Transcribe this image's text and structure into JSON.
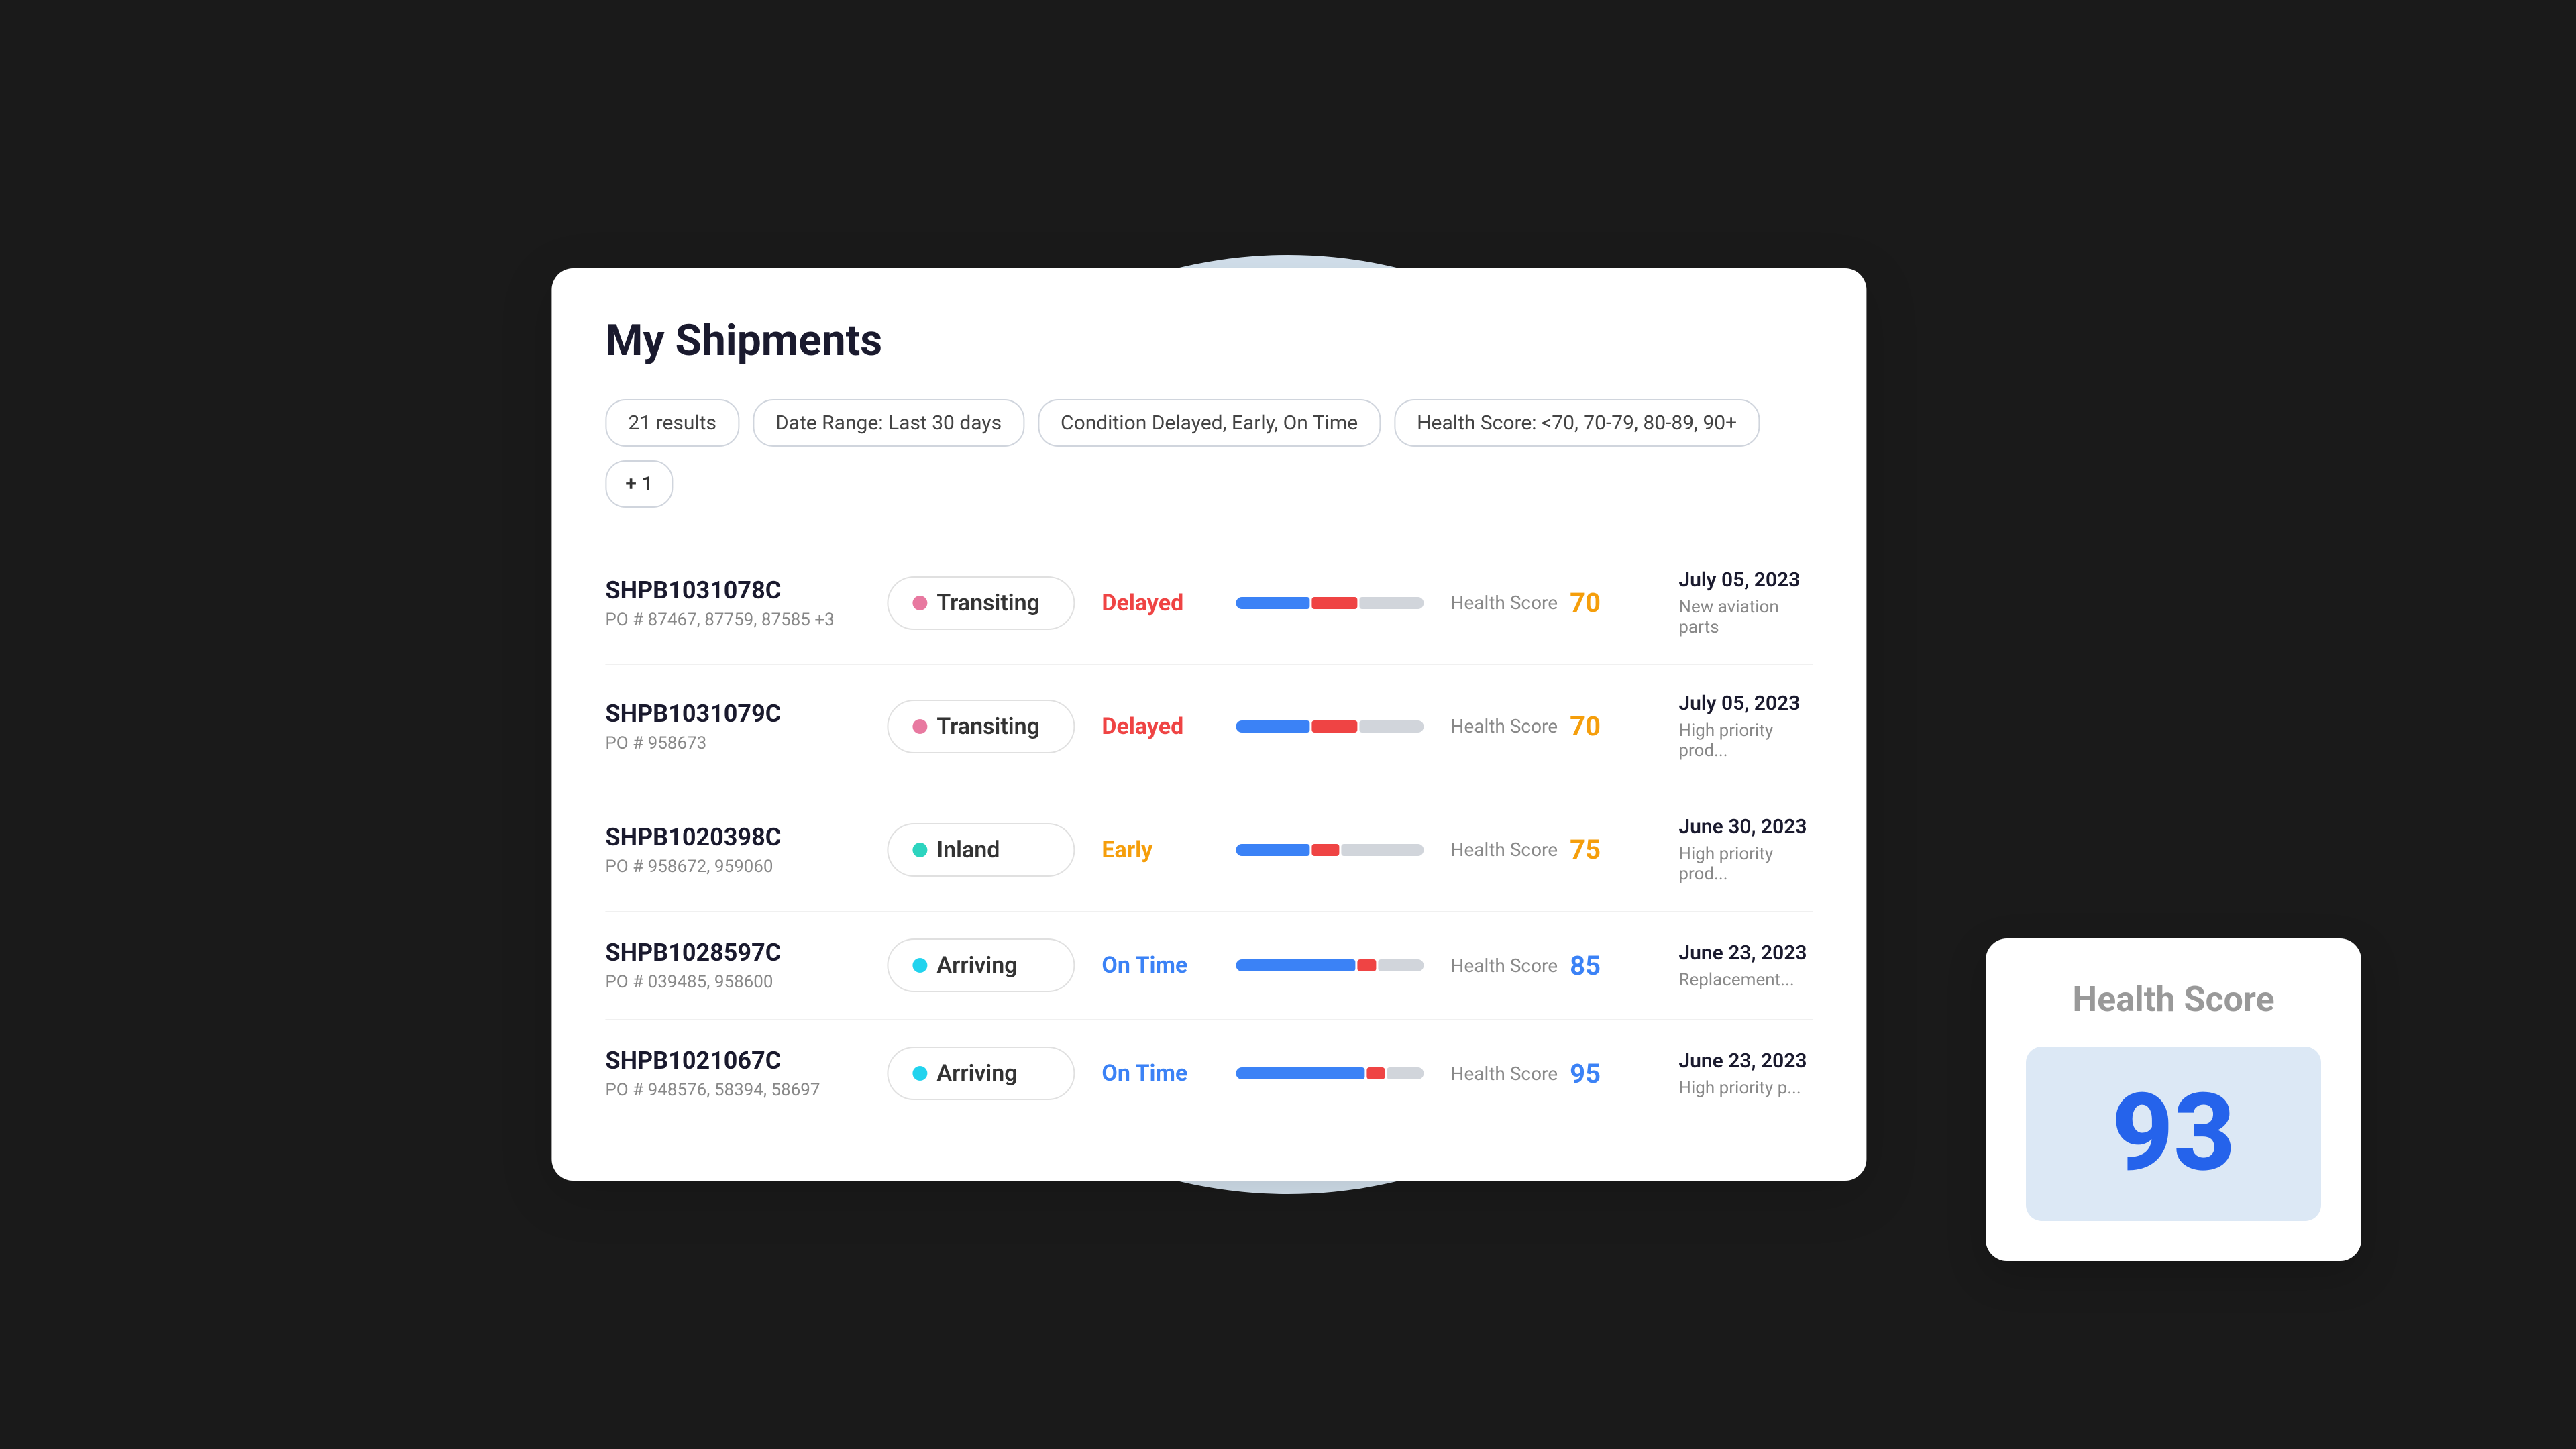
{
  "page": {
    "title": "My Shipments",
    "background_circle_color": "#d6e4f0"
  },
  "filters": [
    {
      "id": "results",
      "label": "21 results"
    },
    {
      "id": "date-range",
      "label": "Date Range: Last 30 days"
    },
    {
      "id": "condition",
      "label": "Condition Delayed, Early, On Time"
    },
    {
      "id": "health-score",
      "label": "Health Score: <70, 70-79, 80-89, 90+"
    },
    {
      "id": "more",
      "label": "+ 1"
    }
  ],
  "shipments": [
    {
      "id": "SHPB1031078C",
      "po": "87467, 87759, 87585 +3",
      "status": "Transiting",
      "status_dot": "pink",
      "condition": "Delayed",
      "condition_class": "delayed",
      "health_score": 70,
      "health_class": "health-70",
      "date": "July 05, 2023",
      "description": "New aviation parts",
      "bar": {
        "blue": 40,
        "red": 25,
        "gray": 35
      }
    },
    {
      "id": "SHPB1031079C",
      "po": "958673",
      "status": "Transiting",
      "status_dot": "pink",
      "condition": "Delayed",
      "condition_class": "delayed",
      "health_score": 70,
      "health_class": "health-70",
      "date": "July 05, 2023",
      "description": "High priority prod...",
      "bar": {
        "blue": 40,
        "red": 25,
        "gray": 35
      }
    },
    {
      "id": "SHPB1020398C",
      "po": "958672, 959060",
      "status": "Inland",
      "status_dot": "teal",
      "condition": "Early",
      "condition_class": "early",
      "health_score": 75,
      "health_class": "health-75",
      "date": "June 30, 2023",
      "description": "High priority prod...",
      "bar": {
        "blue": 40,
        "red": 15,
        "gray": 45
      }
    },
    {
      "id": "SHPB1028597C",
      "po": "039485, 958600",
      "status": "Arriving",
      "status_dot": "cyan",
      "condition": "On Time",
      "condition_class": "ontime",
      "health_score": 85,
      "health_class": "health-85",
      "date": "June 23, 2023",
      "description": "Replacement...",
      "bar": {
        "blue": 65,
        "red": 10,
        "gray": 25
      }
    },
    {
      "id": "SHPB1021067C",
      "po": "948576, 58394, 58697",
      "status": "Arriving",
      "status_dot": "cyan",
      "condition": "On Time",
      "condition_class": "ontime",
      "health_score": 95,
      "health_class": "health-95",
      "date": "June 23, 2023",
      "description": "High priority p...",
      "bar": {
        "blue": 70,
        "red": 10,
        "gray": 20
      }
    }
  ],
  "health_score_card": {
    "title": "Health Score",
    "value": "93"
  },
  "labels": {
    "po_prefix": "PO #",
    "health_label": "Health Score"
  }
}
